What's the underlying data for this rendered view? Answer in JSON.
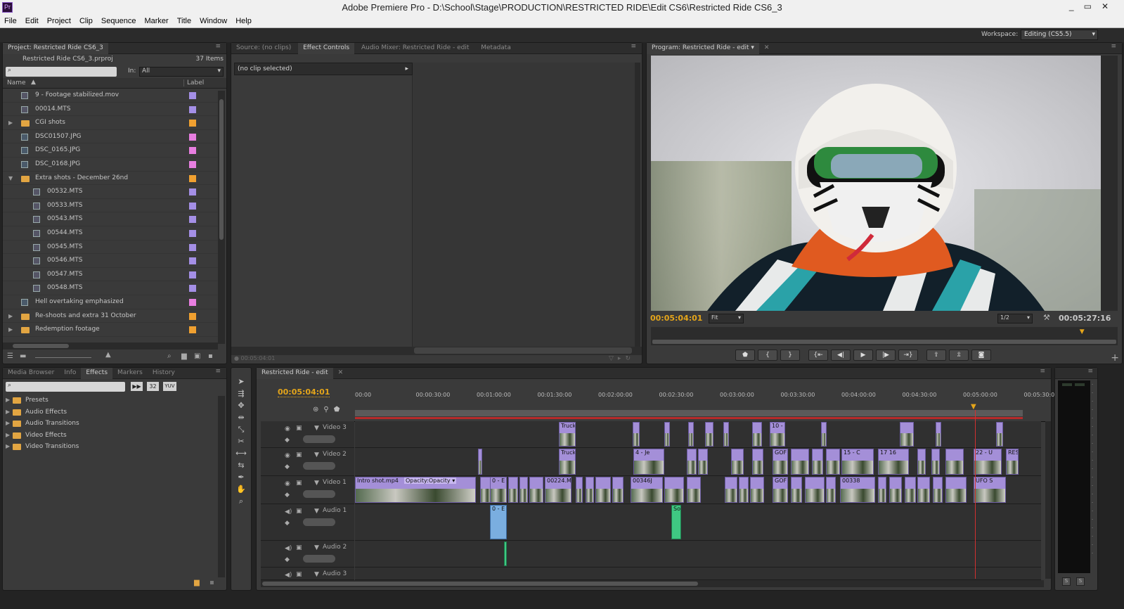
{
  "window": {
    "title": "Adobe Premiere Pro - D:\\School\\Stage\\PRODUCTION\\RESTRICTED RIDE\\Edit CS6\\Restricted Ride CS6_3",
    "controls": [
      "_",
      "▭",
      "✕"
    ]
  },
  "menu": [
    "File",
    "Edit",
    "Project",
    "Clip",
    "Sequence",
    "Marker",
    "Title",
    "Window",
    "Help"
  ],
  "workspace": {
    "label": "Workspace:",
    "value": "Editing (CS5.5)"
  },
  "project": {
    "tab": "Project: Restricted Ride CS6_3",
    "file": "Restricted Ride CS6_3.prproj",
    "count": "37 Items",
    "in_label": "In:",
    "in_value": "All",
    "col_name": "Name",
    "col_label": "Label",
    "items": [
      {
        "name": "9 - Footage stabilized.mov",
        "type": "video",
        "indent": 0,
        "color": "#a48fe6"
      },
      {
        "name": "00014.MTS",
        "type": "video",
        "indent": 0,
        "color": "#a48fe6"
      },
      {
        "name": "CGI shots",
        "type": "folder",
        "indent": 0,
        "expander": "▶",
        "color": "#f0a030"
      },
      {
        "name": "DSC01507.JPG",
        "type": "image",
        "indent": 0,
        "color": "#e87ee0"
      },
      {
        "name": "DSC_0165.JPG",
        "type": "image",
        "indent": 0,
        "color": "#e87ee0"
      },
      {
        "name": "DSC_0168.JPG",
        "type": "image",
        "indent": 0,
        "color": "#e87ee0"
      },
      {
        "name": "Extra shots - December 26nd",
        "type": "folder",
        "indent": 0,
        "expander": "▼",
        "color": "#f0a030"
      },
      {
        "name": "00532.MTS",
        "type": "video",
        "indent": 1,
        "color": "#a48fe6"
      },
      {
        "name": "00533.MTS",
        "type": "video",
        "indent": 1,
        "color": "#a48fe6"
      },
      {
        "name": "00543.MTS",
        "type": "video",
        "indent": 1,
        "color": "#a48fe6"
      },
      {
        "name": "00544.MTS",
        "type": "video",
        "indent": 1,
        "color": "#a48fe6"
      },
      {
        "name": "00545.MTS",
        "type": "video",
        "indent": 1,
        "color": "#a48fe6"
      },
      {
        "name": "00546.MTS",
        "type": "video",
        "indent": 1,
        "color": "#a48fe6"
      },
      {
        "name": "00547.MTS",
        "type": "video",
        "indent": 1,
        "color": "#a48fe6"
      },
      {
        "name": "00548.MTS",
        "type": "video",
        "indent": 1,
        "color": "#a48fe6"
      },
      {
        "name": "Hell overtaking emphasized",
        "type": "image",
        "indent": 0,
        "color": "#e87ee0"
      },
      {
        "name": "Re-shoots and extra 31 October",
        "type": "folder",
        "indent": 0,
        "expander": "▶",
        "color": "#f0a030"
      },
      {
        "name": "Redemption footage",
        "type": "folder",
        "indent": 0,
        "expander": "▶",
        "color": "#f0a030"
      }
    ]
  },
  "source": {
    "tabs": [
      "Source: (no clips)",
      "Effect Controls",
      "Audio Mixer: Restricted Ride - edit",
      "Metadata"
    ],
    "no_clip": "(no clip selected)",
    "timecode": "00:05:04:01"
  },
  "program": {
    "tab": "Program: Restricted Ride - edit",
    "timecode": "00:05:04:01",
    "fit": "Fit",
    "res": "1/2",
    "duration": "00:05:27:16",
    "playhead_position": 0.93
  },
  "effects": {
    "tabs": [
      "Media Browser",
      "Info",
      "Effects",
      "Markers",
      "History"
    ],
    "btns": [
      "32",
      "YUV"
    ],
    "items": [
      "Presets",
      "Audio Effects",
      "Audio Transitions",
      "Video Effects",
      "Video Transitions"
    ]
  },
  "timeline": {
    "tab": "Restricted Ride - edit",
    "timecode": "00:05:04:01",
    "ruler": [
      "00:00",
      "00:00:30:00",
      "00:01:00:00",
      "00:01:30:00",
      "00:02:00:00",
      "00:02:30:00",
      "00:03:00:00",
      "00:03:30:00",
      "00:04:00:00",
      "00:04:30:00",
      "00:05:00:00",
      "00:05:30:00"
    ],
    "tracks": [
      "Video 3",
      "Video 2",
      "Video 1",
      "Audio 1",
      "Audio 2",
      "Audio 3"
    ],
    "clip_labels": {
      "intro": "Intro shot.mp4",
      "opacity": "Opacity:Opacity ▾",
      "truck": "Truck",
      "gof": "GOF",
      "c15": "15 - C",
      "c17": "17 16",
      "c22": "22 - U",
      "res": "RES",
      "c00224": "00224.M",
      "c00346": "00346J",
      "c00338": "00338",
      "ufo": "UFO S",
      "so": "So",
      "e0": "0 - E",
      "c4": "4 - Je",
      "c10": "10 -"
    }
  }
}
